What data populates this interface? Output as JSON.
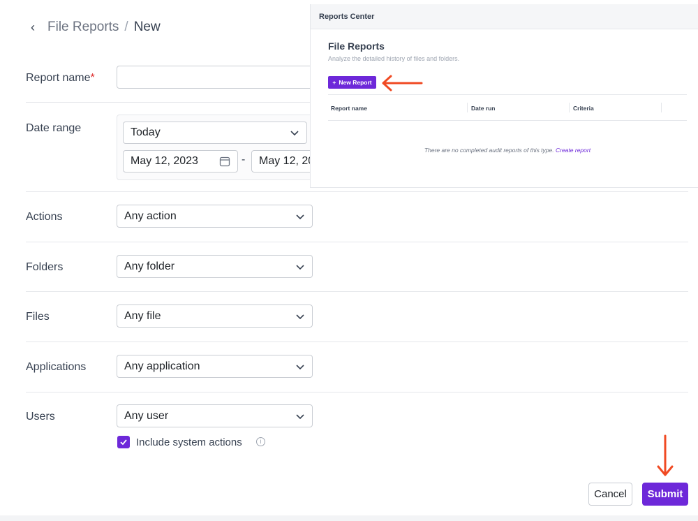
{
  "breadcrumb": {
    "parent": "File Reports",
    "separator": "/",
    "current": "New"
  },
  "form": {
    "report_name": {
      "label": "Report name",
      "required_mark": "*",
      "value": "",
      "placeholder": ""
    },
    "date_range": {
      "label": "Date range",
      "preset": "Today",
      "start": "May 12, 2023",
      "end_visible": "May 12, 20",
      "dash": "-"
    },
    "actions": {
      "label": "Actions",
      "value": "Any action"
    },
    "folders": {
      "label": "Folders",
      "value": "Any folder"
    },
    "files": {
      "label": "Files",
      "value": "Any file"
    },
    "applications": {
      "label": "Applications",
      "value": "Any application"
    },
    "users": {
      "label": "Users",
      "value": "Any user"
    },
    "include_system": {
      "label": "Include system actions",
      "checked": true
    }
  },
  "buttons": {
    "cancel": "Cancel",
    "submit": "Submit"
  },
  "overlay": {
    "window_title": "Reports Center",
    "title": "File Reports",
    "subtitle": "Analyze the detailed history of files and folders.",
    "new_report": "New Report",
    "columns": [
      "Report name",
      "Date run",
      "Criteria"
    ],
    "empty_text": "There are no completed audit reports of this type.",
    "empty_link": "Create report"
  },
  "colors": {
    "accent": "#6d28d9",
    "required": "#dc2626",
    "annotation_arrow": "#f04a23"
  },
  "icons": {
    "back": "chevron-left-icon",
    "dropdown": "chevron-down-icon",
    "calendar": "calendar-icon",
    "check": "check-icon",
    "info": "info-icon",
    "plus": "plus-icon"
  }
}
